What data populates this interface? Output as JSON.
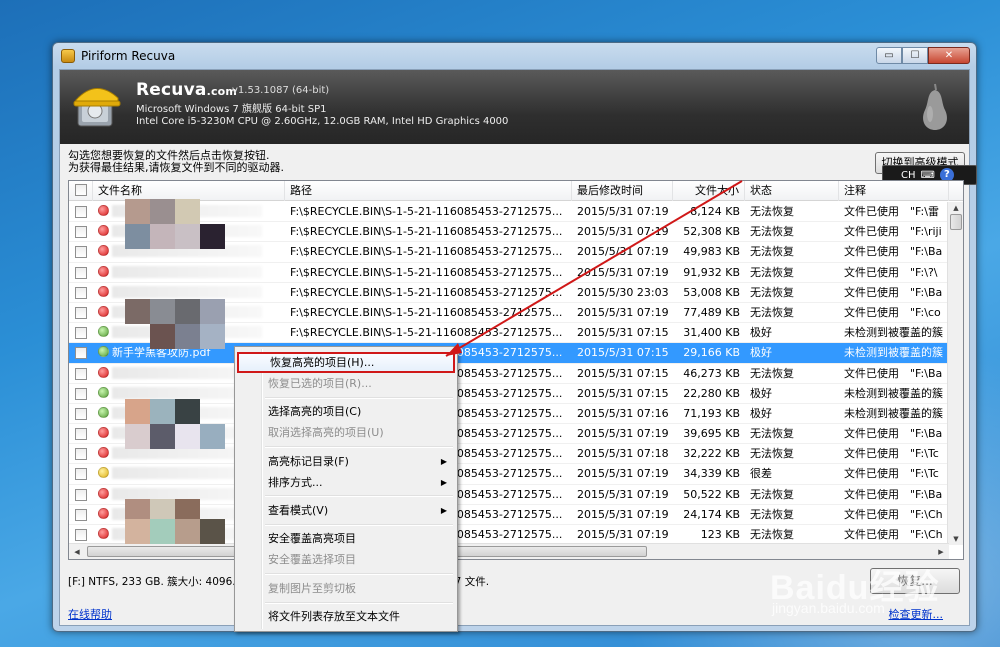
{
  "window": {
    "title": "Piriform Recuva",
    "minimize": "▭",
    "maximize": "☐",
    "close": "✕"
  },
  "header": {
    "brand": "Recuva",
    "brand_suffix": ".com",
    "version": "v1.53.1087 (64-bit)",
    "os": "Microsoft Windows 7 旗舰版 64-bit SP1",
    "hardware": "Intel Core i5-3230M CPU @ 2.60GHz, 12.0GB RAM, Intel HD Graphics 4000"
  },
  "instructions": {
    "line1": "勾选您想要恢复的文件然后点击恢复按钮.",
    "line2": "为获得最佳结果,请恢复文件到不同的驱动器."
  },
  "advanced_button": "切换到高级模式",
  "lang_bar": {
    "lang": "CH",
    "help": "?"
  },
  "columns": {
    "name": "文件名称",
    "path": "路径",
    "date": "最后修改时间",
    "size": "文件大小",
    "state": "状态",
    "note": "注释"
  },
  "rows": [
    {
      "status": "red",
      "name": "",
      "path": "F:\\$RECYCLE.BIN\\S-1-5-21-116085453-2712575...",
      "date": "2015/5/31 07:19",
      "size": "8,124 KB",
      "state": "无法恢复",
      "note": "文件已使用　\"F:\\雷"
    },
    {
      "status": "red",
      "name": "",
      "path": "F:\\$RECYCLE.BIN\\S-1-5-21-116085453-2712575...",
      "date": "2015/5/31 07:19",
      "size": "52,308 KB",
      "state": "无法恢复",
      "note": "文件已使用　\"F:\\riji"
    },
    {
      "status": "red",
      "name": "",
      "path": "F:\\$RECYCLE.BIN\\S-1-5-21-116085453-2712575...",
      "date": "2015/5/31 07:19",
      "size": "49,983 KB",
      "state": "无法恢复",
      "note": "文件已使用　\"F:\\Ba"
    },
    {
      "status": "red",
      "name": "",
      "path": "F:\\$RECYCLE.BIN\\S-1-5-21-116085453-2712575...",
      "date": "2015/5/31 07:19",
      "size": "91,932 KB",
      "state": "无法恢复",
      "note": "文件已使用　\"F:\\?\\"
    },
    {
      "status": "red",
      "name": "",
      "path": "F:\\$RECYCLE.BIN\\S-1-5-21-116085453-2712575...",
      "date": "2015/5/30 23:03",
      "size": "53,008 KB",
      "state": "无法恢复",
      "note": "文件已使用　\"F:\\Ba"
    },
    {
      "status": "red",
      "name": "",
      "path": "F:\\$RECYCLE.BIN\\S-1-5-21-116085453-2712575...",
      "date": "2015/5/31 07:19",
      "size": "77,489 KB",
      "state": "无法恢复",
      "note": "文件已使用　\"F:\\co"
    },
    {
      "status": "green",
      "name": "",
      "path": "F:\\$RECYCLE.BIN\\S-1-5-21-116085453-2712575...",
      "date": "2015/5/31 07:15",
      "size": "31,400 KB",
      "state": "极好",
      "note": "未检测到被覆盖的簇"
    },
    {
      "status": "green",
      "name": "新手学黑客攻防.pdf",
      "path": "F:\\$RECYCLE.BIN\\S-1-5-21-116085453-2712575...",
      "date": "2015/5/31 07:15",
      "size": "29,166 KB",
      "state": "极好",
      "note": "未检测到被覆盖的簇",
      "selected": true
    },
    {
      "status": "red",
      "name": "",
      "path": "F:\\$RECYCLE.BIN\\S-1-5-21-116085453-2712575...",
      "date": "2015/5/31 07:15",
      "size": "46,273 KB",
      "state": "无法恢复",
      "note": "文件已使用　\"F:\\Ba"
    },
    {
      "status": "green",
      "name": "",
      "path": "F:\\$RECYCLE.BIN\\S-1-5-21-116085453-2712575...",
      "date": "2015/5/31 07:15",
      "size": "22,280 KB",
      "state": "极好",
      "note": "未检测到被覆盖的簇"
    },
    {
      "status": "green",
      "name": "",
      "path": "F:\\$RECYCLE.BIN\\S-1-5-21-116085453-2712575...",
      "date": "2015/5/31 07:16",
      "size": "71,193 KB",
      "state": "极好",
      "note": "未检测到被覆盖的簇"
    },
    {
      "status": "red",
      "name": "",
      "path": "F:\\$RECYCLE.BIN\\S-1-5-21-116085453-2712575...",
      "date": "2015/5/31 07:19",
      "size": "39,695 KB",
      "state": "无法恢复",
      "note": "文件已使用　\"F:\\Ba"
    },
    {
      "status": "red",
      "name": "",
      "path": "F:\\$RECYCLE.BIN\\S-1-5-21-116085453-2712575...",
      "date": "2015/5/31 07:18",
      "size": "32,222 KB",
      "state": "无法恢复",
      "note": "文件已使用　\"F:\\Tc"
    },
    {
      "status": "yellow",
      "name": "",
      "path": "F:\\$RECYCLE.BIN\\S-1-5-21-116085453-2712575...",
      "date": "2015/5/31 07:19",
      "size": "34,339 KB",
      "state": "很差",
      "note": "文件已使用　\"F:\\Tc"
    },
    {
      "status": "red",
      "name": "",
      "path": "F:\\$RECYCLE.BIN\\S-1-5-21-116085453-2712575...",
      "date": "2015/5/31 07:19",
      "size": "50,522 KB",
      "state": "无法恢复",
      "note": "文件已使用　\"F:\\Ba"
    },
    {
      "status": "red",
      "name": "",
      "path": "F:\\$RECYCLE.BIN\\S-1-5-21-116085453-2712575...",
      "date": "2015/5/31 07:19",
      "size": "24,174 KB",
      "state": "无法恢复",
      "note": "文件已使用　\"F:\\Ch"
    },
    {
      "status": "red",
      "name": "",
      "path": "F:\\$RECYCLE.BIN\\S-1-5-21-116085453-2712575...",
      "date": "2015/5/31 07:19",
      "size": "123 KB",
      "state": "无法恢复",
      "note": "文件已使用　\"F:\\Ch"
    }
  ],
  "status_bar": "[F:] NTFS, 233 GB. 簇大小: 4096. 文",
  "status_bar_tail": "27 文件.",
  "recover_button": "恢复...",
  "links": {
    "online_help": "在线帮助",
    "check_update": "检查更新..."
  },
  "context_menu": {
    "recover_highlighted": "恢复高亮的项目(H)...",
    "recover_checked": "恢复已选的项目(R)...",
    "check_highlighted": "选择高亮的项目(C)",
    "uncheck_highlighted": "取消选择高亮的项目(U)",
    "highlight_folder": "高亮标记目录(F)",
    "sort_by": "排序方式...",
    "view_mode": "查看模式(V)",
    "secure_overwrite_highlighted": "安全覆盖高亮项目",
    "secure_overwrite_checked": "安全覆盖选择项目",
    "copy_image": "复制图片至剪切板",
    "save_list": "将文件列表存放至文本文件"
  },
  "watermark": {
    "main": "Baidu经验",
    "sub": "jingyan.baidu.com"
  },
  "colors": {
    "selection": "#3399ff",
    "highlight_border": "#d01818",
    "arrow": "#d01818"
  }
}
